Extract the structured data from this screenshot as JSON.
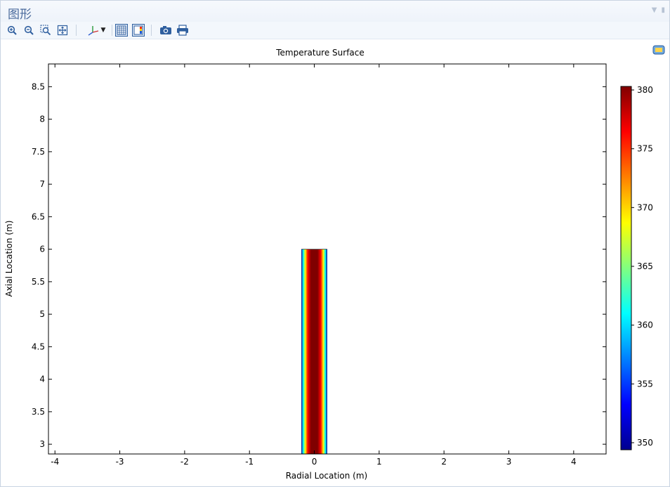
{
  "window": {
    "title": "图形"
  },
  "toolbar": {
    "buttons": [
      {
        "name": "zoom-in-button",
        "icon": "zoom-in-icon"
      },
      {
        "name": "zoom-out-button",
        "icon": "zoom-out-icon"
      },
      {
        "name": "zoom-box-button",
        "icon": "zoom-box-icon"
      },
      {
        "name": "zoom-extents-button",
        "icon": "zoom-extents-icon"
      },
      {
        "name": "axis-orientation-button",
        "icon": "axis-icon"
      },
      {
        "name": "show-grid-button",
        "icon": "grid-icon"
      },
      {
        "name": "show-legend-button",
        "icon": "legend-icon"
      },
      {
        "name": "image-snapshot-button",
        "icon": "camera-icon"
      },
      {
        "name": "print-button",
        "icon": "printer-icon"
      }
    ]
  },
  "colors": {
    "accent": "#4a6a9c",
    "icon_blue": "#2f5f9f"
  },
  "chart_data": {
    "type": "heatmap",
    "title": "Temperature Surface",
    "xlabel": "Radial Location (m)",
    "ylabel": "Axial Location (m)",
    "xlim": [
      -4.1,
      4.5
    ],
    "ylim": [
      2.85,
      8.85
    ],
    "x_ticks": [
      -4,
      -3,
      -2,
      -1,
      0,
      1,
      2,
      3,
      4
    ],
    "x_tick_labels": [
      "-4",
      "-3",
      "-2",
      "-1",
      "0",
      "1",
      "2",
      "3",
      "4"
    ],
    "y_ticks": [
      3,
      3.5,
      4,
      4.5,
      5,
      5.5,
      6,
      6.5,
      7,
      7.5,
      8,
      8.5
    ],
    "y_tick_labels": [
      "3",
      "3.5",
      "4",
      "4.5",
      "5",
      "5.5",
      "6",
      "6.5",
      "7",
      "7.5",
      "8",
      "8.5"
    ],
    "surface": {
      "x_range": [
        -0.2,
        0.2
      ],
      "y_top": 6,
      "radial_profile": [
        {
          "x": -0.2,
          "value": 349
        },
        {
          "x": -0.17,
          "value": 362
        },
        {
          "x": -0.14,
          "value": 368
        },
        {
          "x": -0.1,
          "value": 376
        },
        {
          "x": -0.05,
          "value": 380
        },
        {
          "x": 0,
          "value": 380
        },
        {
          "x": 0.05,
          "value": 380
        },
        {
          "x": 0.1,
          "value": 376
        },
        {
          "x": 0.14,
          "value": 368
        },
        {
          "x": 0.17,
          "value": 360
        },
        {
          "x": 0.2,
          "value": 349
        }
      ]
    },
    "colorbar": {
      "min": 349.4,
      "max": 380.3,
      "ticks": [
        350,
        355,
        360,
        365,
        370,
        375,
        380
      ],
      "tick_labels": [
        "350",
        "355",
        "360",
        "365",
        "370",
        "375",
        "380"
      ],
      "colormap": [
        "#00008f",
        "#0000ff",
        "#0080ff",
        "#00ffff",
        "#80ff80",
        "#ffff00",
        "#ff8000",
        "#ff0000",
        "#800000"
      ]
    },
    "grid": false
  }
}
